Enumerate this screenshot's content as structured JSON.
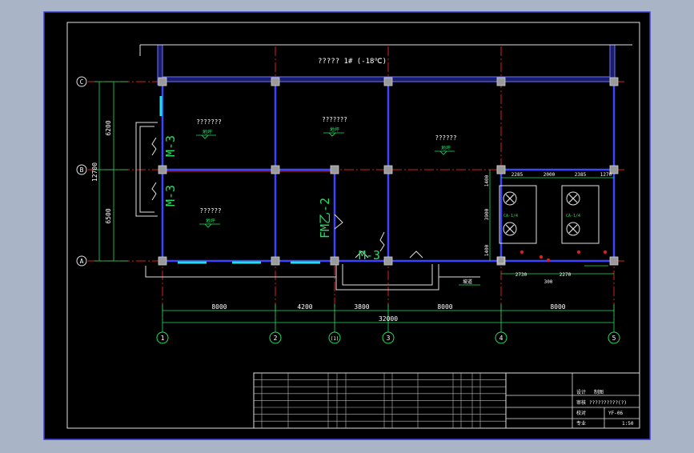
{
  "drawing": {
    "top_room_label": "????? 1# (-18℃)",
    "rooms": [
      {
        "id": "room-1",
        "title": "???????",
        "tag": "地坪"
      },
      {
        "id": "room-2",
        "title": "???????",
        "tag": "地坪"
      },
      {
        "id": "room-3",
        "title": "??????",
        "tag": "地坪"
      },
      {
        "id": "room-4",
        "title": "??????",
        "tag": "地坪"
      }
    ],
    "door_labels": {
      "left_upper": "M-3",
      "left_lower": "M-3",
      "mid": "FM乙-2",
      "bottom": "M-3"
    },
    "entrance_note": "坡道",
    "grid_rows": [
      "C",
      "B",
      "A"
    ],
    "grid_cols": [
      "1",
      "2",
      "(1)",
      "3",
      "4",
      "5"
    ],
    "left_dims": {
      "upper": "6200",
      "lower": "6500",
      "total": "12700"
    },
    "bottom_dims": {
      "spans": [
        "8000",
        "4200",
        "3800",
        "8000",
        "8000"
      ],
      "total": "32000"
    },
    "machine_room": {
      "top_dims": [
        "2285",
        "2000",
        "2385",
        "1270"
      ],
      "side_dims": [
        "1400",
        "3900",
        "1400"
      ],
      "bottom_dims": [
        "2730",
        "300",
        "2270"
      ],
      "unit_labels": [
        "CA-1/4",
        "CA-1/4"
      ]
    },
    "title_block": {
      "drawing_title": "??????????(?)",
      "drawing_number": "YF-06",
      "scale": "1:50",
      "cell_labels": [
        "设计",
        "制图",
        "审核",
        "校对",
        "专业",
        "图号",
        "比例"
      ]
    }
  }
}
